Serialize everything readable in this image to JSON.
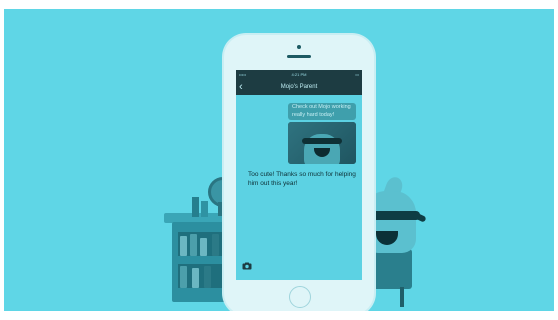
{
  "conversation": {
    "title": "Mojo's Parent",
    "status_time": "4:21 PM",
    "incoming_message": "Check out Mojo working really hard today!",
    "reply_message": "Too cute! Thanks so much for helping him out this year!"
  },
  "icons": {
    "back": "chevron-left-icon",
    "camera": "camera-icon"
  },
  "colors": {
    "background": "#5fd6e6",
    "phone_screen": "#5cd2e3",
    "bubble": "#3f9fac",
    "header": "#1d3c42"
  }
}
